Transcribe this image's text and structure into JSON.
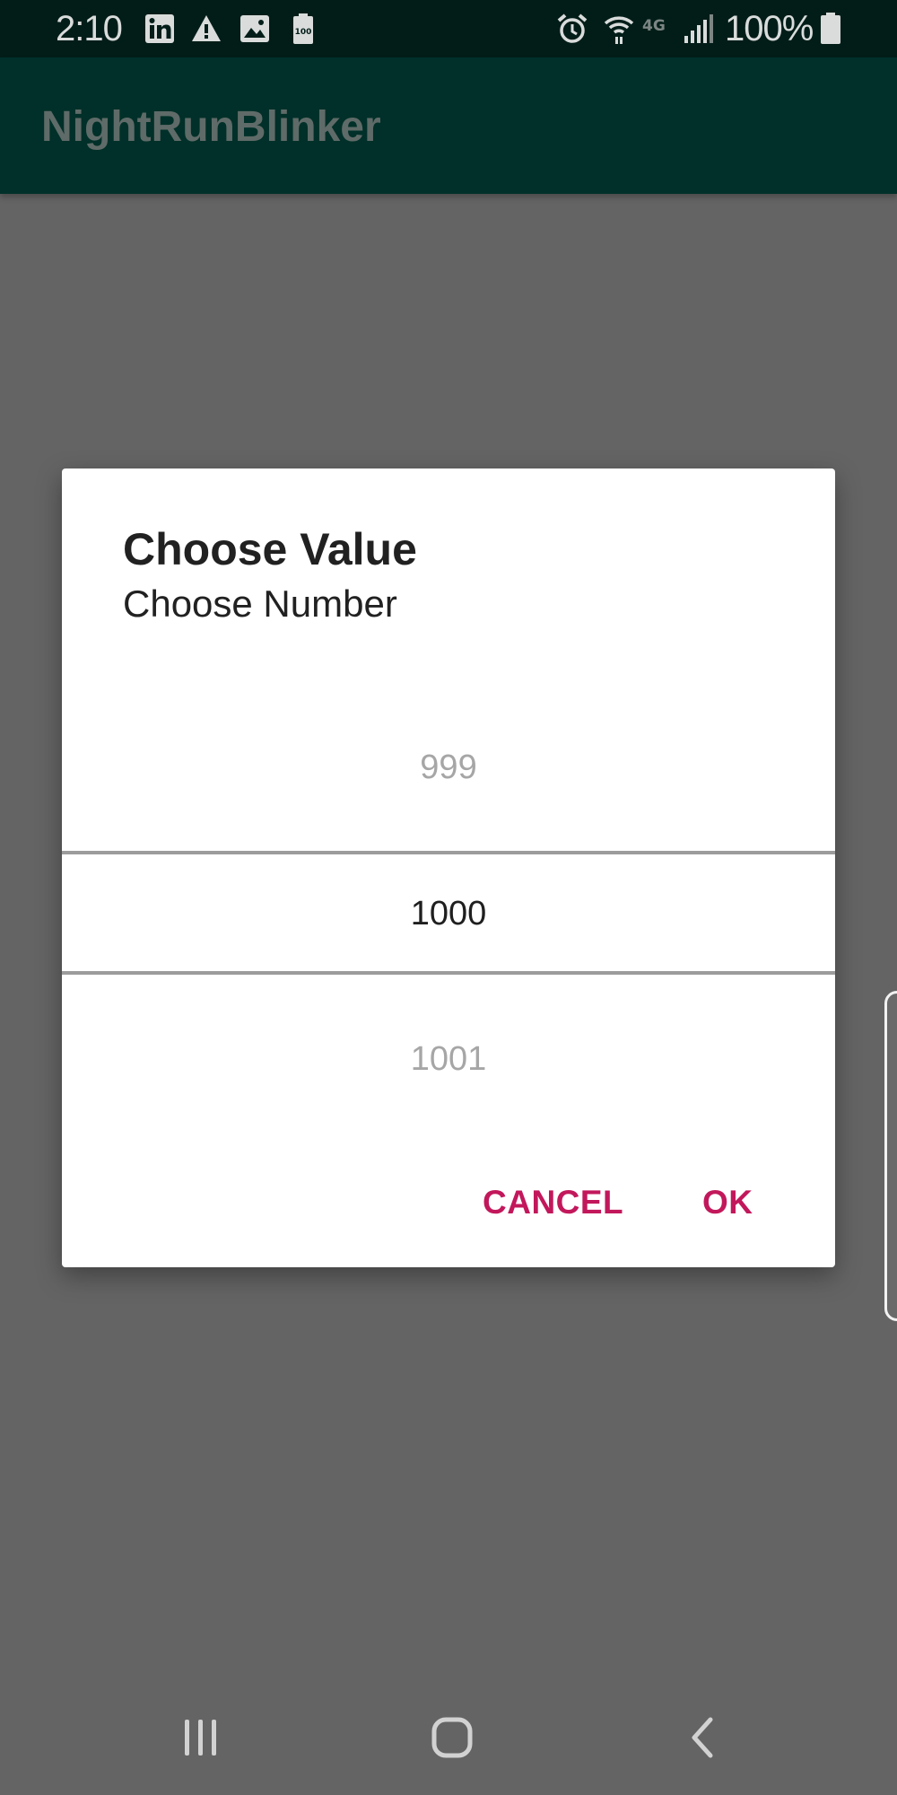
{
  "status_bar": {
    "time": "2:10",
    "battery_percent": "100%",
    "left_icons": [
      "linkedin-icon",
      "warning-icon",
      "image-icon",
      "battery-saver-icon"
    ],
    "right_icons": [
      "alarm-icon",
      "wifi-icon",
      "4g-icon",
      "signal-icon",
      "battery-icon"
    ],
    "battery_saver_label": "100",
    "network_label": "4G"
  },
  "app_bar": {
    "title": "NightRunBlinker"
  },
  "dialog": {
    "title": "Choose Value",
    "subtitle": "Choose Number",
    "picker": {
      "previous": "999",
      "current": "1000",
      "next": "1001"
    },
    "buttons": {
      "cancel": "CANCEL",
      "ok": "OK"
    }
  },
  "nav_bar": {
    "buttons": [
      "recents-icon",
      "home-icon",
      "back-icon"
    ]
  },
  "colors": {
    "status_bar": "#021d18",
    "app_bar": "#003029",
    "scrim_background": "#646464",
    "dialog_background": "#ffffff",
    "accent": "#c2185b",
    "picker_divider": "#9c9c9c"
  }
}
